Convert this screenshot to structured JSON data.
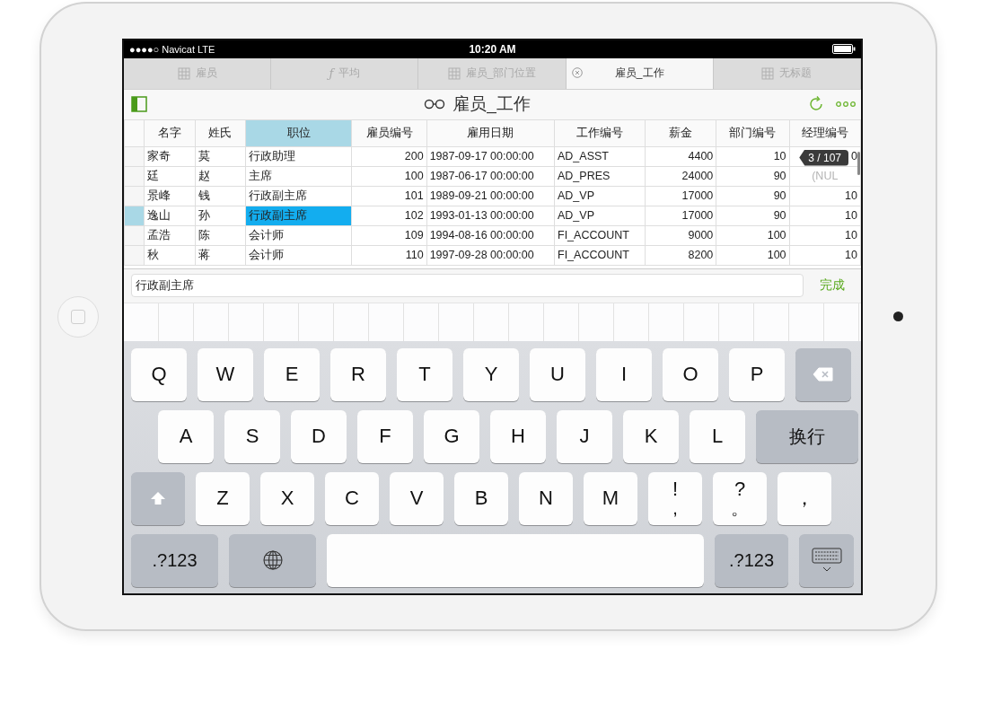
{
  "status_bar": {
    "carrier": "●●●●○ Navicat LTE",
    "time": "10:20 AM"
  },
  "tabs": [
    {
      "label": "雇员",
      "kind": "table",
      "selected": false
    },
    {
      "label": "平均",
      "kind": "function",
      "symbol": "ƒ",
      "selected": false
    },
    {
      "label": "雇员_部门位置",
      "kind": "table",
      "selected": false
    },
    {
      "label": "雇员_工作",
      "kind": "view",
      "selected": true
    },
    {
      "label": "无标题",
      "kind": "table",
      "selected": false
    }
  ],
  "toolbar": {
    "title": "雇员_工作"
  },
  "table": {
    "columns": [
      {
        "label": "名字",
        "kind": "text",
        "selected": false
      },
      {
        "label": "姓氏",
        "kind": "text",
        "selected": false
      },
      {
        "label": "职位",
        "kind": "text",
        "selected": true
      },
      {
        "label": "雇员编号",
        "kind": "number",
        "selected": false
      },
      {
        "label": "雇用日期",
        "kind": "text",
        "selected": false
      },
      {
        "label": "工作编号",
        "kind": "text",
        "selected": false
      },
      {
        "label": "薪金",
        "kind": "number",
        "selected": false
      },
      {
        "label": "部门编号",
        "kind": "number",
        "selected": false
      },
      {
        "label": "经理编号",
        "kind": "number",
        "selected": false
      }
    ],
    "rows": [
      {
        "selected": false,
        "cells": [
          "家奇",
          "莫",
          "行政助理",
          "200",
          "1987-09-17 00:00:00",
          "AD_ASST",
          "4400",
          "10",
          "0"
        ]
      },
      {
        "selected": false,
        "cells": [
          "廷",
          "赵",
          "主席",
          "100",
          "1987-06-17 00:00:00",
          "AD_PRES",
          "24000",
          "90",
          {
            "text": "(NUL",
            "null": true
          }
        ]
      },
      {
        "selected": false,
        "cells": [
          "景峰",
          "钱",
          "行政副主席",
          "101",
          "1989-09-21 00:00:00",
          "AD_VP",
          "17000",
          "90",
          "10"
        ]
      },
      {
        "selected": true,
        "cells": [
          "逸山",
          "孙",
          "行政副主席",
          "102",
          "1993-01-13 00:00:00",
          "AD_VP",
          "17000",
          "90",
          "10"
        ]
      },
      {
        "selected": false,
        "cells": [
          "孟浩",
          "陈",
          "会计师",
          "109",
          "1994-08-16 00:00:00",
          "FI_ACCOUNT",
          "9000",
          "100",
          "10"
        ]
      },
      {
        "selected": false,
        "cells": [
          "秋",
          "蒋",
          "会计师",
          "110",
          "1997-09-28 00:00:00",
          "FI_ACCOUNT",
          "8200",
          "100",
          "10"
        ]
      }
    ],
    "record_badge": "3 / 107"
  },
  "edit_bar": {
    "value": "行政副主席",
    "done": "完成"
  },
  "keyboard": {
    "rows": [
      {
        "keys": [
          {
            "kind": "letter",
            "label": "Q"
          },
          {
            "kind": "letter",
            "label": "W"
          },
          {
            "kind": "letter",
            "label": "E"
          },
          {
            "kind": "letter",
            "label": "R"
          },
          {
            "kind": "letter",
            "label": "T"
          },
          {
            "kind": "letter",
            "label": "Y"
          },
          {
            "kind": "letter",
            "label": "U"
          },
          {
            "kind": "letter",
            "label": "I"
          },
          {
            "kind": "letter",
            "label": "O"
          },
          {
            "kind": "letter",
            "label": "P"
          },
          {
            "kind": "delete"
          }
        ]
      },
      {
        "keys": [
          {
            "kind": "letter",
            "label": "A"
          },
          {
            "kind": "letter",
            "label": "S"
          },
          {
            "kind": "letter",
            "label": "D"
          },
          {
            "kind": "letter",
            "label": "F"
          },
          {
            "kind": "letter",
            "label": "G"
          },
          {
            "kind": "letter",
            "label": "H"
          },
          {
            "kind": "letter",
            "label": "J"
          },
          {
            "kind": "letter",
            "label": "K"
          },
          {
            "kind": "letter",
            "label": "L"
          },
          {
            "kind": "return",
            "label": "换行"
          }
        ]
      },
      {
        "keys": [
          {
            "kind": "shift"
          },
          {
            "kind": "letter",
            "label": "Z"
          },
          {
            "kind": "letter",
            "label": "X"
          },
          {
            "kind": "letter",
            "label": "C"
          },
          {
            "kind": "letter",
            "label": "V"
          },
          {
            "kind": "letter",
            "label": "B"
          },
          {
            "kind": "letter",
            "label": "N"
          },
          {
            "kind": "letter",
            "label": "M"
          },
          {
            "kind": "dual",
            "label": "!",
            "sub": ","
          },
          {
            "kind": "dual",
            "label": "?",
            "sub": "。"
          },
          {
            "kind": "letter",
            "label": "，"
          }
        ]
      },
      {
        "keys": [
          {
            "kind": "mode",
            "label": ".?123"
          },
          {
            "kind": "globe"
          },
          {
            "kind": "space"
          },
          {
            "kind": "mode",
            "label": ".?123"
          },
          {
            "kind": "hide"
          }
        ]
      }
    ]
  }
}
